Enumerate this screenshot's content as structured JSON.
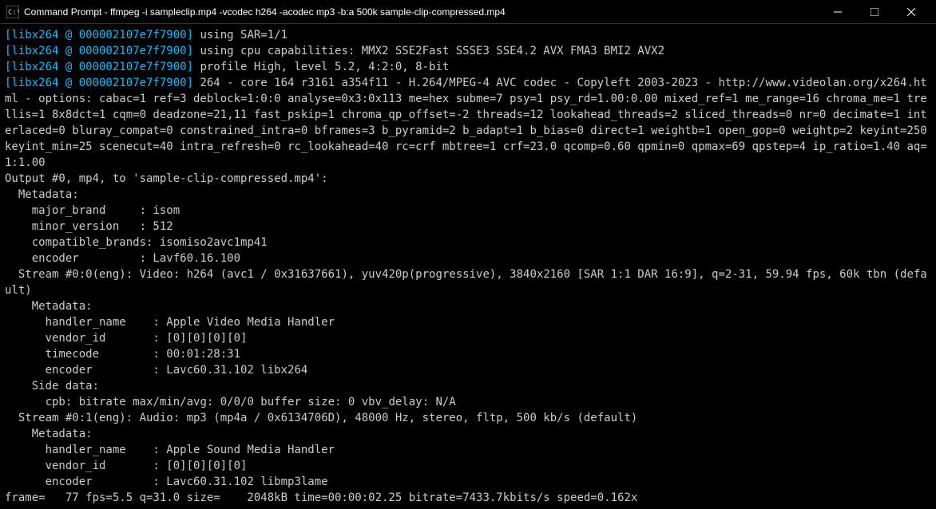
{
  "window": {
    "title": "Command Prompt - ffmpeg  -i sampleclip.mp4 -vcodec h264 -acodec mp3 -b:a 500k sample-clip-compressed.mp4"
  },
  "lines": {
    "l1_prefix": "[libx264 @ 000002107e7f7900]",
    "l1_text": " using SAR=1/1",
    "l2_prefix": "[libx264 @ 000002107e7f7900]",
    "l2_text": " using cpu capabilities: MMX2 SSE2Fast SSSE3 SSE4.2 AVX FMA3 BMI2 AVX2",
    "l3_prefix": "[libx264 @ 000002107e7f7900]",
    "l3_text": " profile High, level 5.2, 4:2:0, 8-bit",
    "l4_prefix": "[libx264 @ 000002107e7f7900]",
    "l4_text": " 264 - core 164 r3161 a354f11 - H.264/MPEG-4 AVC codec - Copyleft 2003-2023 - http://www.videolan.org/x264.html - options: cabac=1 ref=3 deblock=1:0:0 analyse=0x3:0x113 me=hex subme=7 psy=1 psy_rd=1.00:0.00 mixed_ref=1 me_range=16 chroma_me=1 trellis=1 8x8dct=1 cqm=0 deadzone=21,11 fast_pskip=1 chroma_qp_offset=-2 threads=12 lookahead_threads=2 sliced_threads=0 nr=0 decimate=1 interlaced=0 bluray_compat=0 constrained_intra=0 bframes=3 b_pyramid=2 b_adapt=1 b_bias=0 direct=1 weightb=1 open_gop=0 weightp=2 keyint=250 keyint_min=25 scenecut=40 intra_refresh=0 rc_lookahead=40 rc=crf mbtree=1 crf=23.0 qcomp=0.60 qpmin=0 qpmax=69 qpstep=4 ip_ratio=1.40 aq=1:1.00",
    "l5": "Output #0, mp4, to 'sample-clip-compressed.mp4':",
    "l6": "  Metadata:",
    "l7": "    major_brand     : isom",
    "l8": "    minor_version   : 512",
    "l9": "    compatible_brands: isomiso2avc1mp41",
    "l10": "    encoder         : Lavf60.16.100",
    "l11": "  Stream #0:0(eng): Video: h264 (avc1 / 0x31637661), yuv420p(progressive), 3840x2160 [SAR 1:1 DAR 16:9], q=2-31, 59.94 fps, 60k tbn (default)",
    "l12": "    Metadata:",
    "l13": "      handler_name    : Apple Video Media Handler",
    "l14": "      vendor_id       : [0][0][0][0]",
    "l15": "      timecode        : 00:01:28:31",
    "l16": "      encoder         : Lavc60.31.102 libx264",
    "l17": "    Side data:",
    "l18": "      cpb: bitrate max/min/avg: 0/0/0 buffer size: 0 vbv_delay: N/A",
    "l19": "  Stream #0:1(eng): Audio: mp3 (mp4a / 0x6134706D), 48000 Hz, stereo, fltp, 500 kb/s (default)",
    "l20": "    Metadata:",
    "l21": "      handler_name    : Apple Sound Media Handler",
    "l22": "      vendor_id       : [0][0][0][0]",
    "l23": "      encoder         : Lavc60.31.102 libmp3lame",
    "l24": "frame=   77 fps=5.5 q=31.0 size=    2048kB time=00:00:02.25 bitrate=7433.7kbits/s speed=0.162x"
  }
}
